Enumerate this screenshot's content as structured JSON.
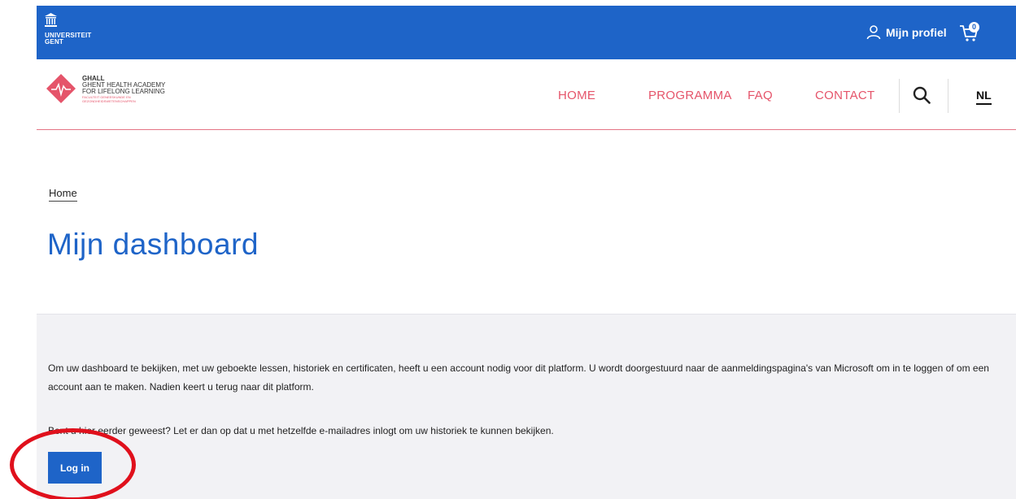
{
  "topbar": {
    "university_logo_text": "UNIVERSITEIT\nGENT",
    "profile_label": "Mijn profiel",
    "cart_count": "0",
    "bg_color": "#1e64c8"
  },
  "header": {
    "logo": {
      "line1": "GHALL",
      "line2": "GHENT HEALTH ACADEMY",
      "line3": "FOR LIFELONG LEARNING",
      "line4": "FACULTEIT GENEESKUNDE EN",
      "line5": "GEZONDHEIDSWETENSCHAPPEN"
    },
    "nav": [
      {
        "label": "HOME"
      },
      {
        "label": "PROGRAMMA"
      },
      {
        "label": "FAQ"
      },
      {
        "label": "CONTACT"
      }
    ],
    "language": "NL",
    "accent_color": "#e5546a"
  },
  "breadcrumb": "Home",
  "page_title": "Mijn dashboard",
  "panel": {
    "text1": "Om uw dashboard te bekijken, met uw geboekte lessen, historiek en certificaten, heeft u een account nodig voor dit platform. U wordt doorgestuurd naar de aanmeldingspagina's van Microsoft om in te loggen of om een account aan te maken. Nadien keert u terug naar dit platform.",
    "text2": "Bent u hier eerder geweest? Let er dan op dat u met hetzelfde e-mailadres inlogt om uw historiek te kunnen bekijken.",
    "login_button": "Log in"
  },
  "icons": {
    "university": "university-building-icon",
    "profile": "user-icon",
    "cart": "cart-icon",
    "search": "search-icon",
    "ghall_logo": "ghall-diamond-logo"
  }
}
